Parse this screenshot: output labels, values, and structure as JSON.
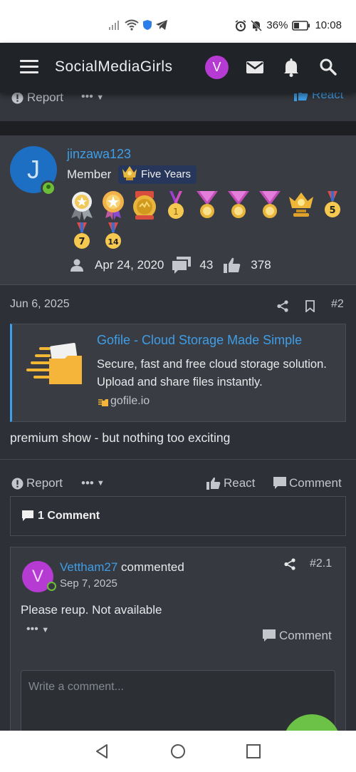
{
  "status_bar": {
    "battery": "36%",
    "time": "10:08"
  },
  "header": {
    "title": "SocialMediaGirls",
    "avatar_letter": "V"
  },
  "prev_post_footer": {
    "report": "Report",
    "more": "•••",
    "react": "React"
  },
  "user": {
    "avatar_letter": "J",
    "username": "jinzawa123",
    "role": "Member",
    "badge": "Five Years",
    "joined": "Apr 24, 2020",
    "messages": "43",
    "reactions": "378",
    "trophy_labels": [
      "1",
      "5",
      "7",
      "14"
    ]
  },
  "post": {
    "date": "Jun 6, 2025",
    "number": "#2",
    "embed": {
      "title": "Gofile - Cloud Storage Made Simple",
      "description": "Secure, fast and free cloud storage solution. Upload and share files instantly.",
      "site": "gofile.io"
    },
    "text": "premium show - but nothing too exciting"
  },
  "post_footer": {
    "report": "Report",
    "more": "•••",
    "react": "React",
    "comment": "Comment"
  },
  "comments_header": "1 Comment",
  "comment": {
    "avatar_letter": "V",
    "user": "Vettham27",
    "verb": "commented",
    "date": "Sep 7, 2025",
    "number": "#2.1",
    "body": "Please reup. Not available",
    "more": "•••",
    "comment_label": "Comment"
  },
  "comment_input": {
    "placeholder": "Write a comment..."
  },
  "colors": {
    "accent": "#3e9ee8",
    "avatar_user": "#1d6fc4",
    "avatar_v": "#b63bd3",
    "online": "#6bbd3a"
  }
}
